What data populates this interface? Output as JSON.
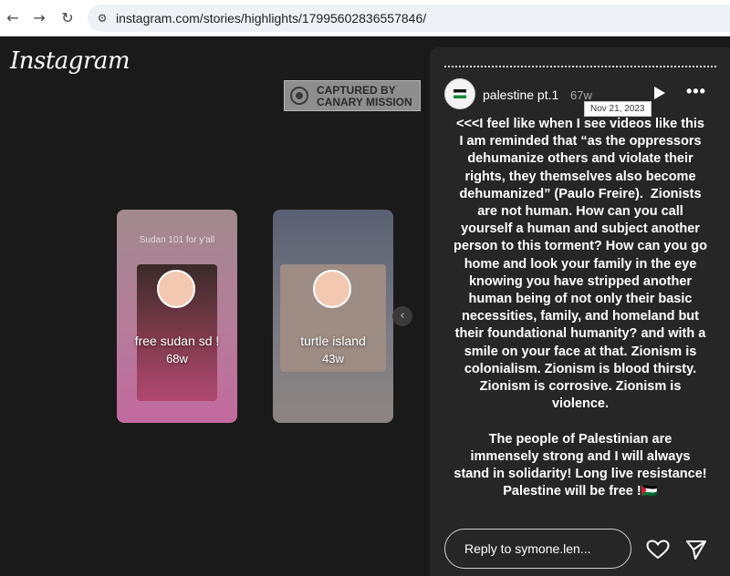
{
  "browser": {
    "back_glyph": "←",
    "forward_glyph": "→",
    "reload_glyph": "↻",
    "site_info_glyph": "⚙",
    "url": "instagram.com/stories/highlights/17995602836557846/"
  },
  "page": {
    "logo_text": "Instagram",
    "watermark": "CAPTURED BY CANARY MISSION",
    "highlights": [
      {
        "caption_top": "Sudan 101 for y'all",
        "title": "free sudan sd !",
        "age": "68w"
      },
      {
        "caption_top": "",
        "title": "turtle island",
        "age": "43w"
      }
    ],
    "prev_arrow_glyph": "‹"
  },
  "story": {
    "title": "palestine pt.1",
    "age": "67w",
    "tooltip": "Nov 21, 2023",
    "more_glyph": "•••",
    "text": "<<<I feel like when I see videos like this I am reminded that “as the oppressors dehumanize others and violate their rights, they themselves also become dehumanized” (Paulo Freire).  Zionists are not human. How can you call yourself a human and subject another person to this torment? How can you go home and look your family in the eye knowing you have stripped another human being of not only their basic necessities, family, and homeland but their foundational humanity? and with a smile on your face at that. Zionism is colonialism. Zionism is blood thirsty. Zionism is corrosive. Zionism is violence.\n\nThe people of Palestinian are immensely strong and I will always stand in solidarity! Long live resistance! Palestine will be free !🇵🇸",
    "reply_placeholder": "Reply to symone.len..."
  },
  "colors": {
    "background": "#1a1a1a",
    "story_panel": "#262626",
    "text": "#ffffff"
  },
  "icons": [
    "back-icon",
    "forward-icon",
    "reload-icon",
    "site-info-icon",
    "play-icon",
    "more-icon",
    "heart-icon",
    "send-icon",
    "chevron-left-icon"
  ]
}
